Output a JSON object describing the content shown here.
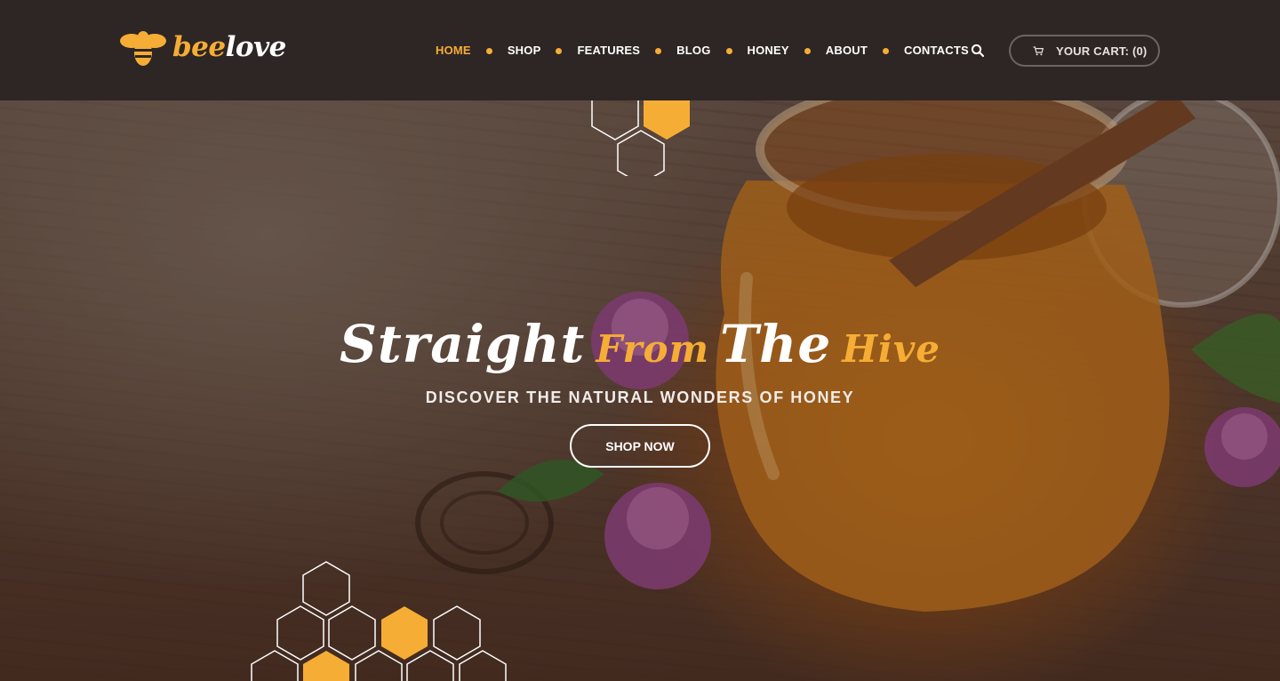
{
  "brand": {
    "name_part1": "bee",
    "name_part2": "love",
    "accent_color": "#f6ad35"
  },
  "nav": {
    "items": [
      {
        "label": "HOME",
        "active": true
      },
      {
        "label": "SHOP",
        "active": false
      },
      {
        "label": "FEATURES",
        "active": false
      },
      {
        "label": "BLOG",
        "active": false
      },
      {
        "label": "HONEY",
        "active": false
      },
      {
        "label": "ABOUT",
        "active": false
      },
      {
        "label": "CONTACTS",
        "active": false
      }
    ]
  },
  "header": {
    "search_icon": "search-icon",
    "cart_icon": "cart-icon",
    "cart_label": "YOUR CART: (0)"
  },
  "hero": {
    "title_word1": "Straight",
    "title_word2": "From",
    "title_word3": "The",
    "title_word4": "Hive",
    "subtitle": "DISCOVER THE NATURAL WONDERS OF HONEY",
    "cta_label": "SHOP NOW"
  }
}
